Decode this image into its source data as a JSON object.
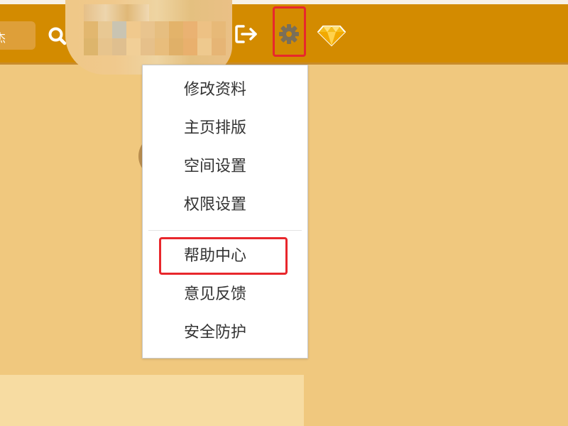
{
  "header": {
    "search_text": "杰",
    "icons": [
      "search-icon",
      "logout-icon",
      "gear-icon",
      "diamond-icon"
    ],
    "colors": {
      "topbar": "#d38b00",
      "page_background": "#f0c87e",
      "highlight": "#e8272c",
      "diamond": "#f2b705"
    }
  },
  "settings_menu": {
    "items": [
      {
        "label": "修改资料"
      },
      {
        "label": "主页排版"
      },
      {
        "label": "空间设置"
      },
      {
        "label": "权限设置"
      },
      {
        "label": "帮助中心",
        "highlighted": true
      },
      {
        "label": "意见反馈"
      },
      {
        "label": "安全防护"
      }
    ]
  }
}
